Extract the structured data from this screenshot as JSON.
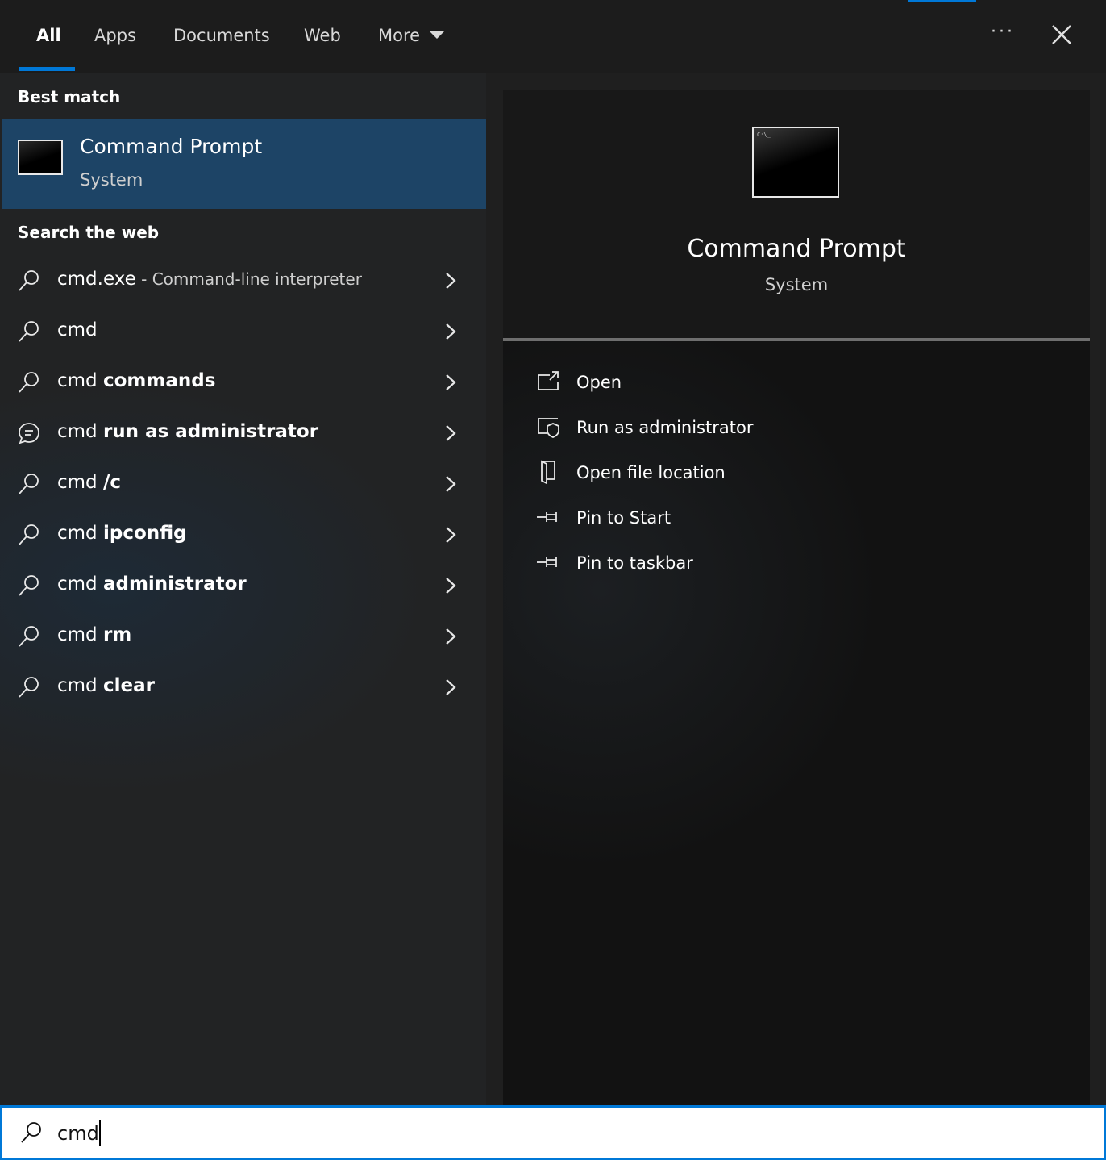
{
  "tabs": [
    {
      "label": "All",
      "active": true
    },
    {
      "label": "Apps"
    },
    {
      "label": "Documents"
    },
    {
      "label": "Web"
    },
    {
      "label": "More"
    }
  ],
  "topbar": {
    "ellipsis_label": "···"
  },
  "sections": {
    "best_match": "Best match",
    "search_web": "Search the web"
  },
  "best_match": {
    "title": "Command Prompt",
    "subtitle": "System"
  },
  "web_results": [
    {
      "prefix": "cmd.exe",
      "bold": "",
      "desc": " - Command-line interpreter",
      "icon": "search-icon"
    },
    {
      "prefix": "cmd",
      "bold": "",
      "desc": "",
      "icon": "search-icon"
    },
    {
      "prefix": "cmd ",
      "bold": "commands",
      "desc": "",
      "icon": "search-icon"
    },
    {
      "prefix": "cmd ",
      "bold": "run as administrator",
      "desc": "",
      "icon": "chat-bubble-icon"
    },
    {
      "prefix": "cmd ",
      "bold": "/c",
      "desc": "",
      "icon": "search-icon"
    },
    {
      "prefix": "cmd ",
      "bold": "ipconfig",
      "desc": "",
      "icon": "search-icon"
    },
    {
      "prefix": "cmd ",
      "bold": "administrator",
      "desc": "",
      "icon": "search-icon"
    },
    {
      "prefix": "cmd ",
      "bold": "rm",
      "desc": "",
      "icon": "search-icon"
    },
    {
      "prefix": "cmd ",
      "bold": "clear",
      "desc": "",
      "icon": "search-icon"
    }
  ],
  "detail": {
    "title": "Command Prompt",
    "subtitle": "System",
    "thumb_text": "C:\\_",
    "actions": [
      {
        "label": "Open",
        "icon": "open-icon"
      },
      {
        "label": "Run as administrator",
        "icon": "shield-icon"
      },
      {
        "label": "Open file location",
        "icon": "file-location-icon"
      },
      {
        "label": "Pin to Start",
        "icon": "pin-icon"
      },
      {
        "label": "Pin to taskbar",
        "icon": "pin-icon"
      }
    ]
  },
  "search": {
    "value": "cmd",
    "placeholder": ""
  },
  "colors": {
    "accent": "#0078d7",
    "selected_row": "#1d4466",
    "background": "#1f1f1f"
  }
}
